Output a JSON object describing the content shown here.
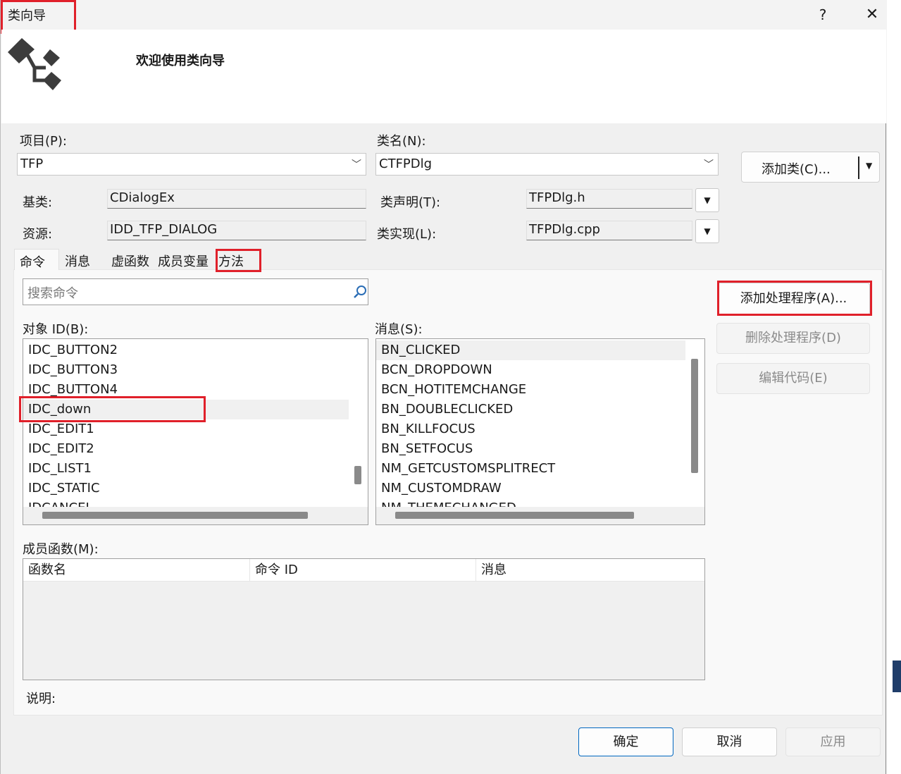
{
  "window": {
    "title": "类向导",
    "help": "?",
    "close": "✕",
    "banner_title": "欢迎使用类向导"
  },
  "form": {
    "project_label": "项目(P):",
    "project_value": "TFP",
    "classname_label": "类名(N):",
    "classname_value": "CTFPDlg",
    "add_class_button": "添加类(C)...",
    "base_class_label": "基类:",
    "base_class_value": "CDialogEx",
    "resource_label": "资源:",
    "resource_value": "IDD_TFP_DIALOG",
    "class_decl_label": "类声明(T):",
    "class_decl_value": "TFPDlg.h",
    "class_impl_label": "类实现(L):",
    "class_impl_value": "TFPDlg.cpp"
  },
  "tabs": [
    {
      "label": "命令"
    },
    {
      "label": "消息"
    },
    {
      "label": "虚函数"
    },
    {
      "label": "成员变量"
    },
    {
      "label": "方法"
    }
  ],
  "search": {
    "placeholder": "搜索命令"
  },
  "object_ids": {
    "label": "对象 ID(B):",
    "items": [
      "IDC_BUTTON2",
      "IDC_BUTTON3",
      "IDC_BUTTON4",
      "IDC_down",
      "IDC_EDIT1",
      "IDC_EDIT2",
      "IDC_LIST1",
      "IDC_STATIC",
      "IDCANCEL"
    ],
    "selected_index": 3
  },
  "messages": {
    "label": "消息(S):",
    "items": [
      "BN_CLICKED",
      "BCN_DROPDOWN",
      "BCN_HOTITEMCHANGE",
      "BN_DOUBLECLICKED",
      "BN_KILLFOCUS",
      "BN_SETFOCUS",
      "NM_GETCUSTOMSPLITRECT",
      "NM_CUSTOMDRAW",
      "NM_THEMECHANGED"
    ],
    "selected_index": 0
  },
  "actions": {
    "add_handler": "添加处理程序(A)...",
    "delete_handler": "删除处理程序(D)",
    "edit_code": "编辑代码(E)"
  },
  "member_functions": {
    "label": "成员函数(M):",
    "columns": [
      "函数名",
      "命令 ID",
      "消息"
    ]
  },
  "description_label": "说明:",
  "footer": {
    "ok": "确定",
    "cancel": "取消",
    "apply": "应用"
  },
  "colors": {
    "highlight": "#e0202a",
    "accent": "#0067c0"
  }
}
